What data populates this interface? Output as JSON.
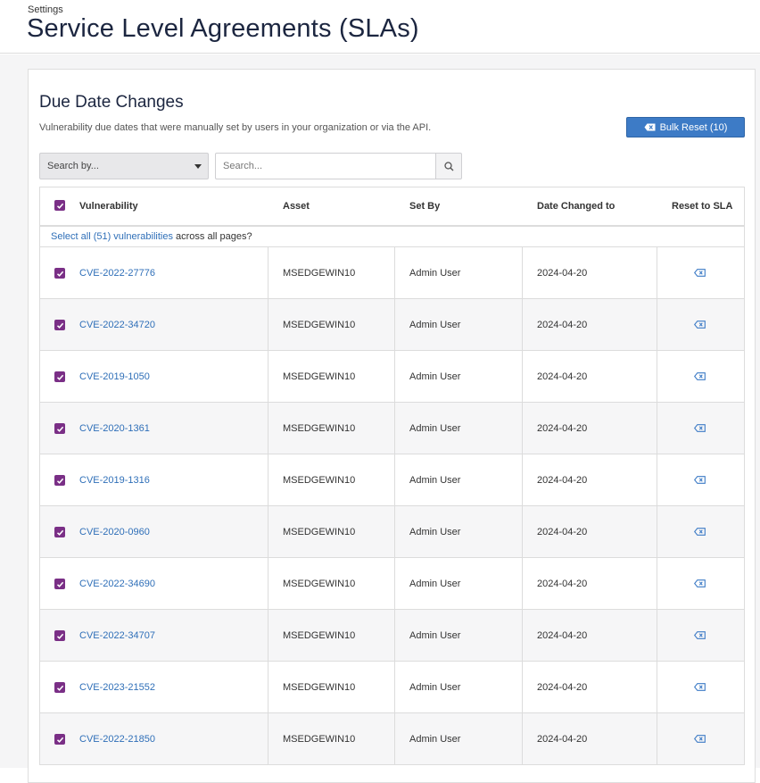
{
  "header": {
    "breadcrumb": "Settings",
    "title": "Service Level Agreements (SLAs)"
  },
  "section": {
    "title": "Due Date Changes",
    "description": "Vulnerability due dates that were manually set by users in your organization or via the API.",
    "bulk_reset_label": "Bulk Reset (10)",
    "search_by_label": "Search by...",
    "search_placeholder": "Search..."
  },
  "colors": {
    "accent": "#3d7bc6",
    "checkbox": "#7a2f86",
    "link": "#2f6fb8"
  },
  "table": {
    "columns": [
      "Vulnerability",
      "Asset",
      "Set By",
      "Date Changed to",
      "Reset to SLA"
    ],
    "select_all_link": "Select all (51) vulnerabilities",
    "select_all_suffix": "across all pages?",
    "rows": [
      {
        "vuln": "CVE-2022-27776",
        "asset": "MSEDGEWIN10",
        "set_by": "Admin User",
        "date": "2024-04-20"
      },
      {
        "vuln": "CVE-2022-34720",
        "asset": "MSEDGEWIN10",
        "set_by": "Admin User",
        "date": "2024-04-20"
      },
      {
        "vuln": "CVE-2019-1050",
        "asset": "MSEDGEWIN10",
        "set_by": "Admin User",
        "date": "2024-04-20"
      },
      {
        "vuln": "CVE-2020-1361",
        "asset": "MSEDGEWIN10",
        "set_by": "Admin User",
        "date": "2024-04-20"
      },
      {
        "vuln": "CVE-2019-1316",
        "asset": "MSEDGEWIN10",
        "set_by": "Admin User",
        "date": "2024-04-20"
      },
      {
        "vuln": "CVE-2020-0960",
        "asset": "MSEDGEWIN10",
        "set_by": "Admin User",
        "date": "2024-04-20"
      },
      {
        "vuln": "CVE-2022-34690",
        "asset": "MSEDGEWIN10",
        "set_by": "Admin User",
        "date": "2024-04-20"
      },
      {
        "vuln": "CVE-2022-34707",
        "asset": "MSEDGEWIN10",
        "set_by": "Admin User",
        "date": "2024-04-20"
      },
      {
        "vuln": "CVE-2023-21552",
        "asset": "MSEDGEWIN10",
        "set_by": "Admin User",
        "date": "2024-04-20"
      },
      {
        "vuln": "CVE-2022-21850",
        "asset": "MSEDGEWIN10",
        "set_by": "Admin User",
        "date": "2024-04-20"
      }
    ]
  }
}
